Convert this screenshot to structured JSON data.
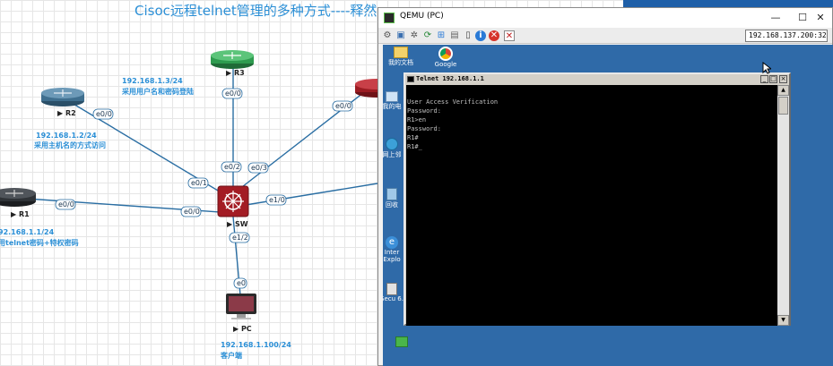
{
  "topology": {
    "title": "Cisoc远程telnet管理的多种方式----释然",
    "devices": [
      {
        "key": "r1",
        "name": "R1",
        "info_ip": "92.168.1.1/24",
        "info_desc": "用telnet密码+特权密码"
      },
      {
        "key": "r2",
        "name": "R2",
        "info_ip": "192.168.1.2/24",
        "info_desc": "采用主机名的方式访问"
      },
      {
        "key": "r3",
        "name": "R3",
        "info_ip": "192.168.1.3/24",
        "info_desc": "采用用户名和密码登陆"
      },
      {
        "key": "sw",
        "name": "SW"
      },
      {
        "key": "pc",
        "name": "PC",
        "info_ip": "192.168.1.100/24",
        "info_desc": "客户端"
      }
    ],
    "ports": {
      "r1_e00": "e0/0",
      "r2_e00": "e0/0",
      "r3_e00": "e0/0",
      "r4_e00": "e0/0",
      "pc_e0": "e0",
      "sw_e00": "e0/0",
      "sw_e01": "e0/1",
      "sw_e02": "e0/2",
      "sw_e03": "e0/3",
      "sw_e10": "e1/0",
      "sw_e12": "e1/2"
    },
    "colors": {
      "router_dark": "#2f3337",
      "router_blue": "#3f6f8f",
      "router_green": "#2e9b4f",
      "router_red": "#9b1c22",
      "switch_red": "#a31c24",
      "link": "#2a6ea3",
      "info_text": "#2b8fd6"
    }
  },
  "qemu": {
    "title": "QEMU (PC)",
    "address": "192.168.137.200:32",
    "toolbar_icons": [
      "settings-icon",
      "fullscreen-icon",
      "gear-icon",
      "refresh-icon",
      "windows-icon",
      "drive-icon",
      "text-icon",
      "info-icon",
      "stop-icon",
      "doc-icon"
    ],
    "window_controls": {
      "minimize": "—",
      "maximize": "☐",
      "close": "✕"
    },
    "desktop_icons": [
      {
        "label": "我的文档",
        "icon": "folder-icon"
      },
      {
        "label": "Google",
        "icon": "chrome-icon"
      },
      {
        "label": "我的电",
        "icon": "computer-icon"
      },
      {
        "label": "网上邻",
        "icon": "network-icon"
      },
      {
        "label": "回收",
        "icon": "recycle-bin-icon"
      },
      {
        "label": "Inter Explo",
        "icon": "ie-icon"
      },
      {
        "label": "Secu 6.",
        "icon": "security-icon"
      }
    ]
  },
  "telnet": {
    "title": "Telnet 192.168.1.1",
    "lines": [
      "",
      "User Access Verification",
      "",
      "Password:",
      "R1>en",
      "Password:",
      "R1#",
      "R1#_"
    ]
  }
}
